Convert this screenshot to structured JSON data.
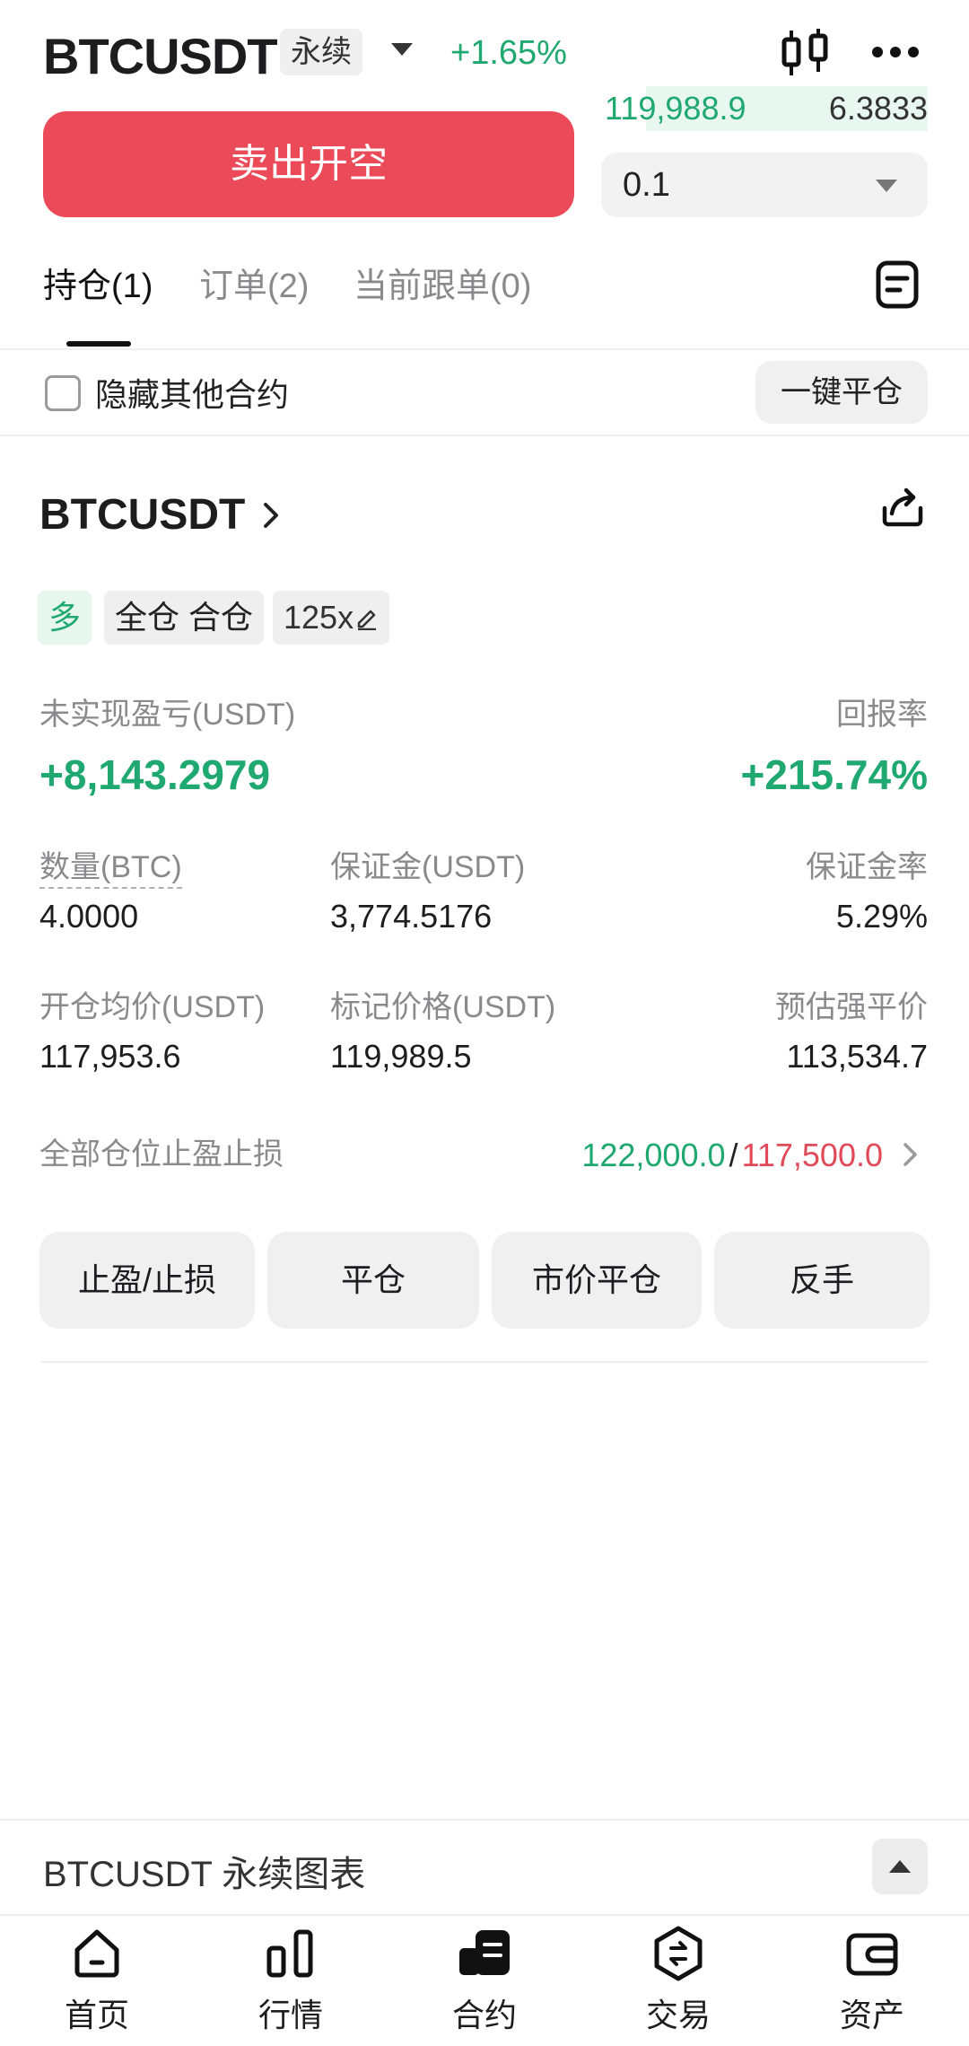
{
  "header": {
    "symbol": "BTCUSDT",
    "contract_type": "永续",
    "change": "+1.65%"
  },
  "orderbook": {
    "price": "119,988.9",
    "size": "6.3833"
  },
  "trade": {
    "sell_button": "卖出开空",
    "quantity": "0.1"
  },
  "tabs": [
    {
      "label": "持仓",
      "count": "(1)"
    },
    {
      "label": "订单",
      "count": "(2)"
    },
    {
      "label": "当前跟单",
      "count": "(0)"
    }
  ],
  "filters": {
    "hide_label": "隐藏其他合约",
    "close_all": "一键平仓"
  },
  "position": {
    "symbol": "BTCUSDT",
    "tags": {
      "side": "多",
      "margin_mode": "全仓 合仓",
      "leverage": "125x"
    },
    "unrealized_pnl_label": "未实现盈亏(USDT)",
    "unrealized_pnl": "+8,143.2979",
    "roe_label": "回报率",
    "roe": "+215.74%",
    "qty_label": "数量(BTC)",
    "qty": "4.0000",
    "margin_label": "保证金(USDT)",
    "margin": "3,774.5176",
    "margin_ratio_label": "保证金率",
    "margin_ratio": "5.29%",
    "entry_label": "开仓均价(USDT)",
    "entry": "117,953.6",
    "mark_label": "标记价格(USDT)",
    "mark": "119,989.5",
    "liq_label": "预估强平价",
    "liq": "113,534.7",
    "tpsl_label": "全部仓位止盈止损",
    "tp": "122,000.0",
    "separator": "/",
    "sl": "117,500.0",
    "actions": [
      "止盈/止损",
      "平仓",
      "市价平仓",
      "反手"
    ]
  },
  "chart_bar": {
    "title": "BTCUSDT 永续图表"
  },
  "nav": [
    {
      "label": "首页",
      "icon": "home-icon"
    },
    {
      "label": "行情",
      "icon": "market-icon"
    },
    {
      "label": "合约",
      "icon": "futures-icon"
    },
    {
      "label": "交易",
      "icon": "trade-icon"
    },
    {
      "label": "资产",
      "icon": "wallet-icon"
    }
  ],
  "colors": {
    "green": "#1fa870",
    "red": "#e04a59",
    "sell_button": "#eb4a58"
  }
}
